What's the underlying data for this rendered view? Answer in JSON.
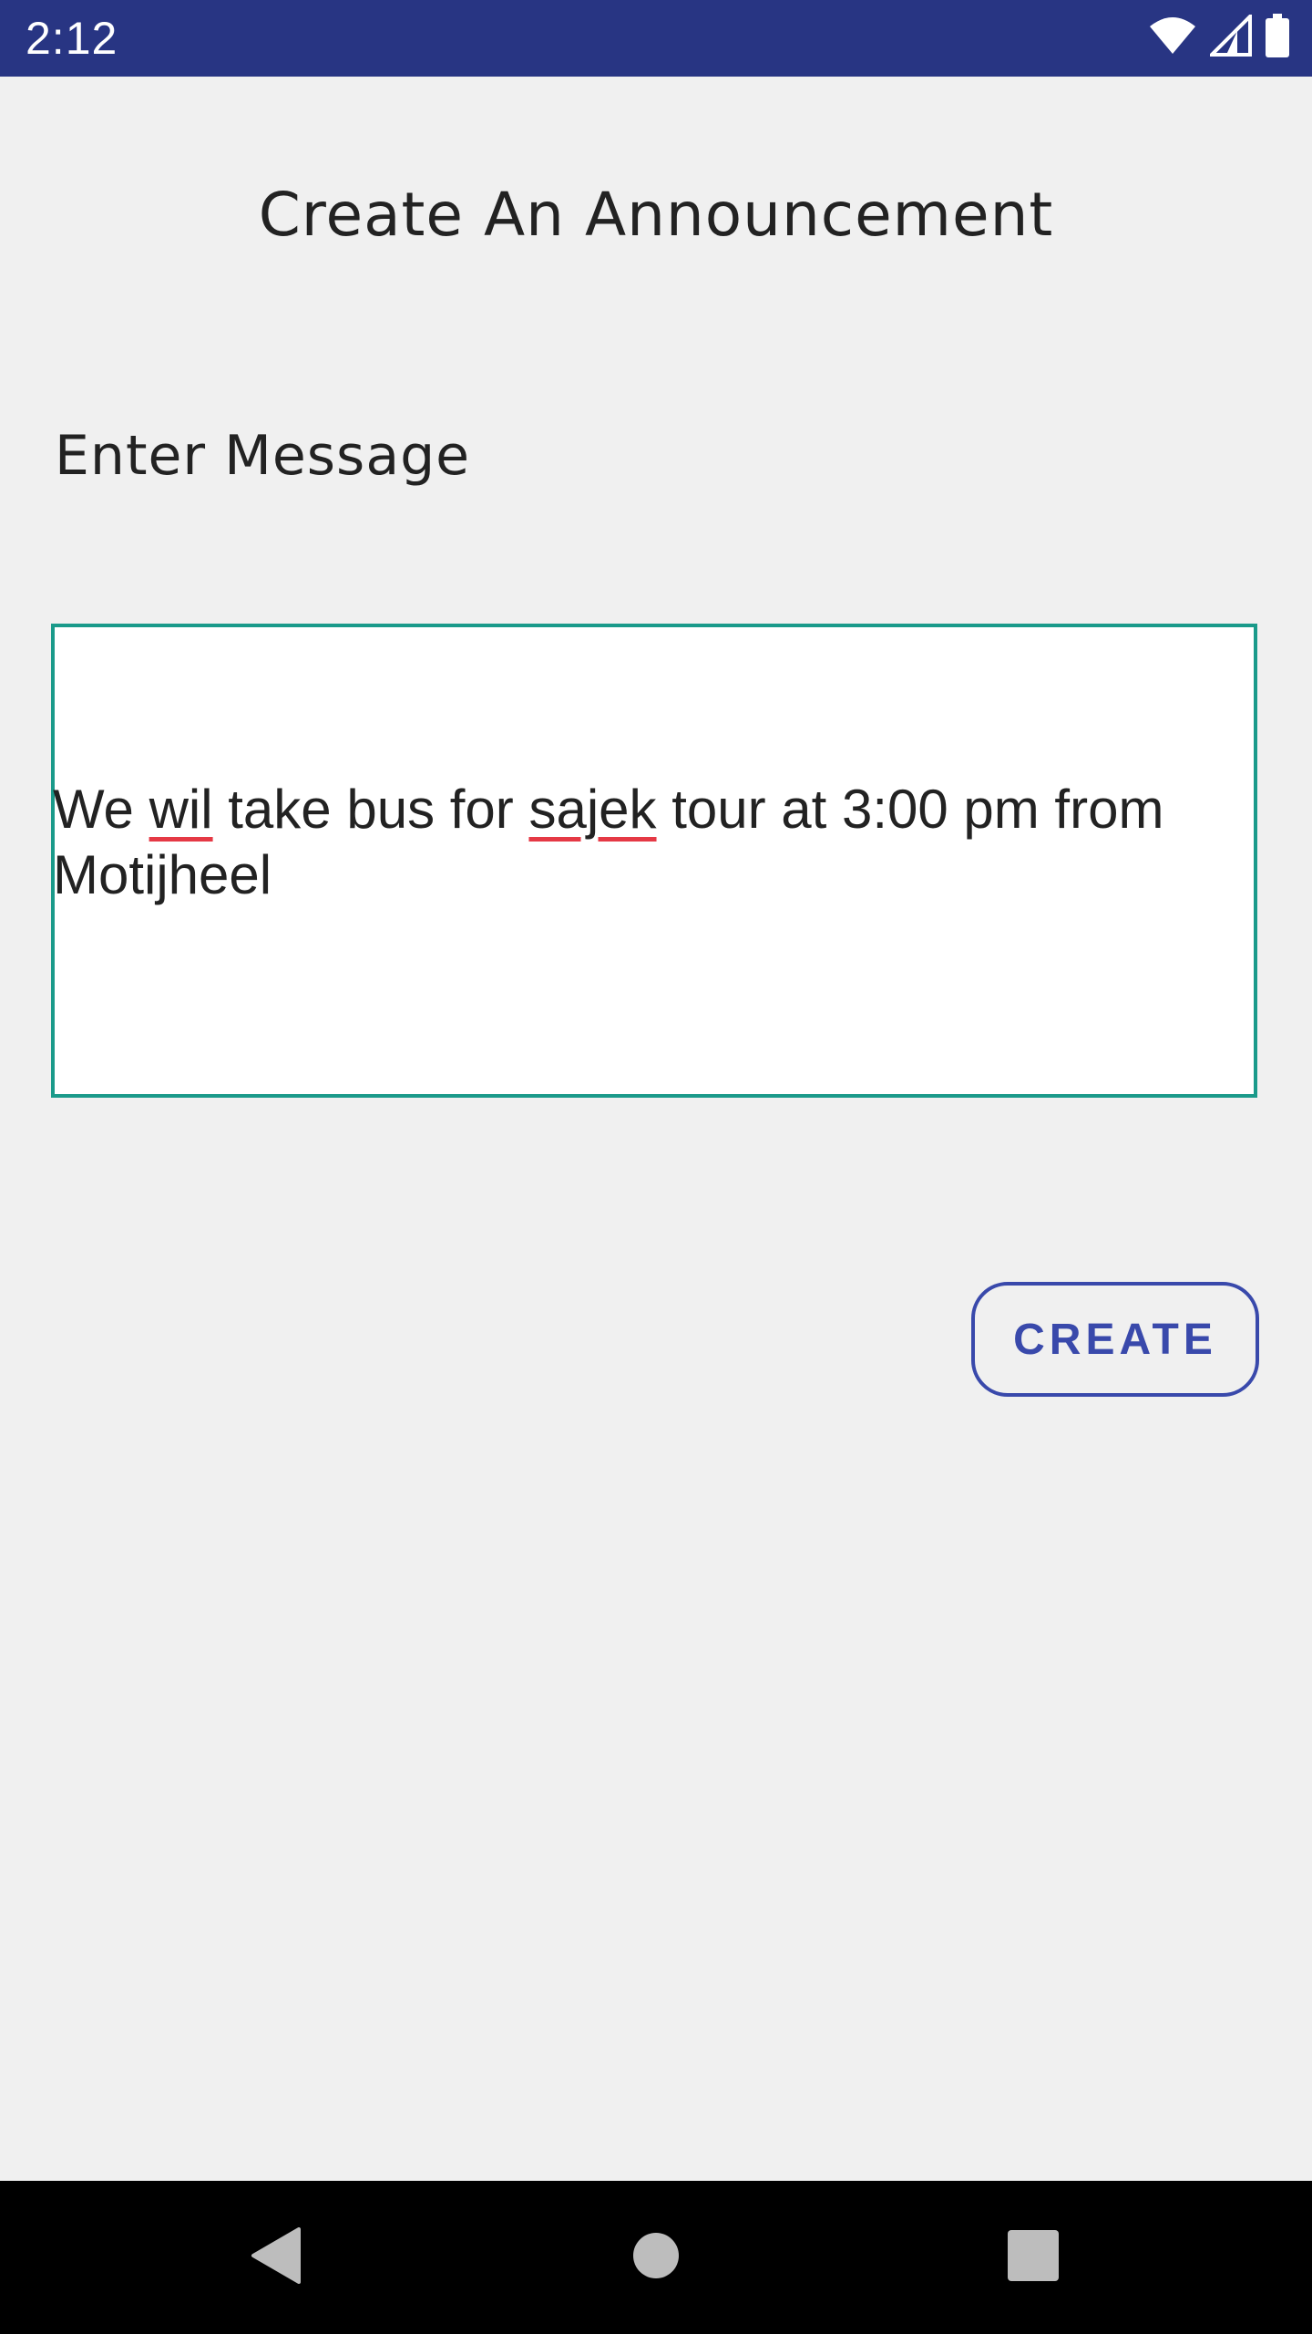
{
  "status_bar": {
    "time": "2:12",
    "icons": [
      "wifi-icon",
      "cell-signal-icon",
      "battery-icon"
    ],
    "background_color": "#283583"
  },
  "page": {
    "title": "Create An Announcement",
    "message_label": "Enter Message",
    "message": {
      "segments": [
        "We ",
        "wil",
        " take bus for ",
        "sajek",
        " tour at 3:00 pm from Motijheel"
      ],
      "misspelled_words": [
        "wil",
        "sajek"
      ]
    },
    "create_button_label": "CREATE",
    "accent_color": "#3949ab",
    "field_border_color": "#1a9a8a"
  },
  "nav_bar": {
    "buttons": [
      "back-icon",
      "home-icon",
      "recents-icon"
    ]
  }
}
